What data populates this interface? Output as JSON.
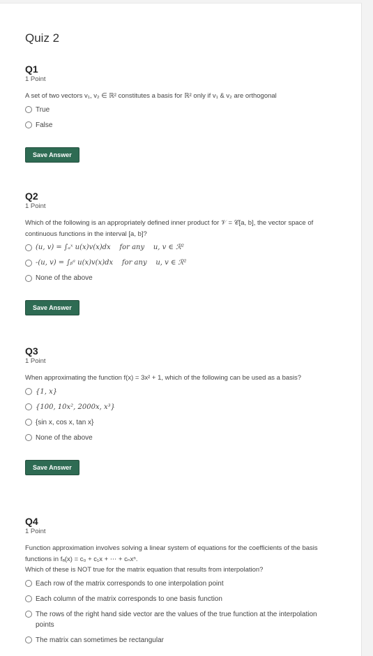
{
  "quiz_title": "Quiz 2",
  "questions": [
    {
      "name": "Q1",
      "points": "1 Point",
      "text": "A set of two vectors v₁, v₂ ∈ ℝ² constitutes a basis for ℝ² only if v₁ & v₂ are orthogonal",
      "options": [
        "True",
        "False"
      ],
      "save_label": "Save Answer"
    },
    {
      "name": "Q2",
      "points": "1 Point",
      "text": "Which of the following is an appropriately defined inner product for 𝒱 = 𝒞[a, b], the vector space of continuous functions in the interval [a, b]?",
      "options": [
        "(u, v) = ∫ₐˣ u(x)v(x)dx    for any    u, v ∈ ℛ²",
        "-(u, v) = ∫ᵦᵃ u(x)v(x)dx    for any    u, v ∈ ℛ²",
        "None of the above"
      ],
      "save_label": "Save Answer"
    },
    {
      "name": "Q3",
      "points": "1 Point",
      "text": "When approximating the function f(x) = 3x² + 1, which of the following can be used as a basis?",
      "options": [
        "{1, x}",
        "{100, 10x², 2000x, x³}",
        "{sin x, cos x, tan x}",
        "None of the above"
      ],
      "save_label": "Save Answer"
    },
    {
      "name": "Q4",
      "points": "1 Point",
      "text": "Function approximation involves solving a linear system of equations for the coefficients of the basis functions in fₐ(x) = c₀ + c₁x + ⋯ + cₙxⁿ.",
      "text2": "Which of these is NOT true for the matrix equation that results from interpolation?",
      "options": [
        "Each row of the matrix corresponds to one interpolation point",
        "Each column of the matrix corresponds to one basis function",
        "The rows of the right hand side vector are the values of the true function at the interpolation points",
        "The matrix can sometimes be rectangular"
      ]
    }
  ]
}
